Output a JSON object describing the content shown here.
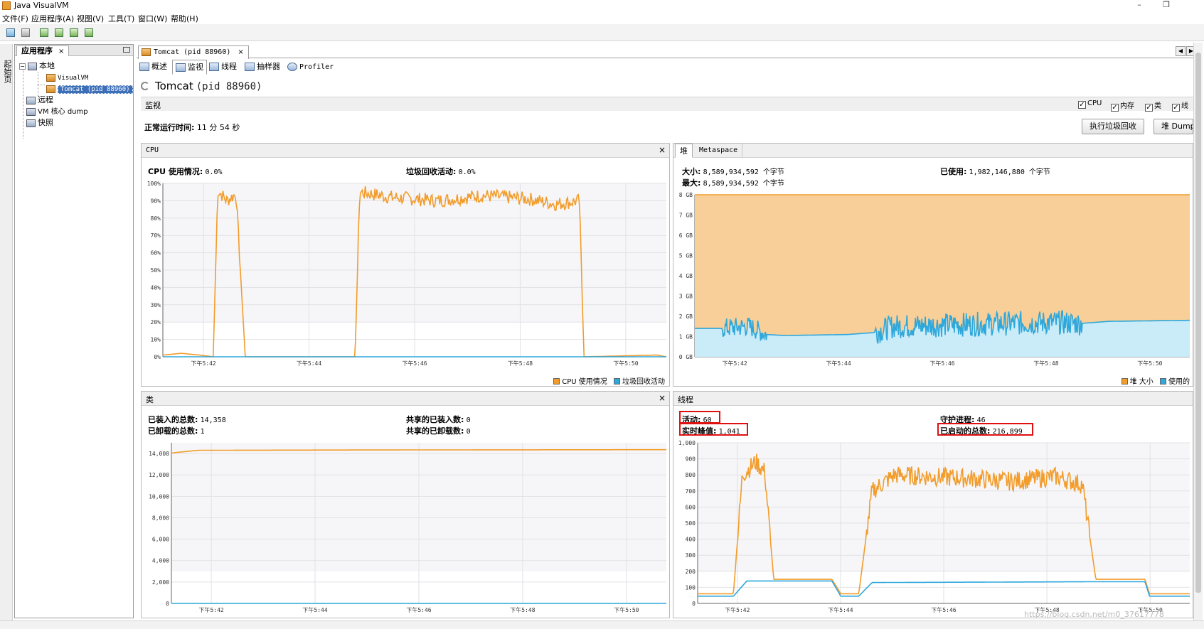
{
  "window": {
    "title": "Java VisualVM"
  },
  "menu": [
    "文件(F)",
    "应用程序(A)",
    "视图(V)",
    "工具(T)",
    "窗口(W)",
    "帮助(H)"
  ],
  "sidestrip": {
    "label": "起始页"
  },
  "left_panel": {
    "tab_label": "应用程序",
    "tree": {
      "local": "本地",
      "visualvm": "VisualVM",
      "tomcat": "Tomcat (pid 88960)",
      "remote": "远程",
      "vm_coredump": "VM 核心 dump",
      "snapshot": "快照"
    }
  },
  "doc_tab": {
    "label": "Tomcat (pid 88960)"
  },
  "sub_tabs": [
    "概述",
    "监视",
    "线程",
    "抽样器",
    "Profiler"
  ],
  "page": {
    "app_name": "Tomcat",
    "pid": "(pid 88960)"
  },
  "monitor": {
    "section_label": "监视",
    "checkboxes": [
      "CPU",
      "内存",
      "类",
      "线"
    ],
    "uptime_label": "正常运行时间:",
    "uptime_value": "11 分 54 秒",
    "gc_button": "执行垃圾回收",
    "dump_button": "堆 Dump"
  },
  "cpu_panel": {
    "title": "CPU",
    "cpu_usage_label": "CPU 使用情况:",
    "cpu_usage_value": "0.0%",
    "gc_activity_label": "垃圾回收活动:",
    "gc_activity_value": "0.0%",
    "legend": [
      "CPU 使用情况",
      "垃圾回收活动"
    ]
  },
  "heap_panel": {
    "tabs": [
      "堆",
      "Metaspace"
    ],
    "size_label": "大小:",
    "size_value": "8,589,934,592 个字节",
    "max_label": "最大:",
    "max_value": "8,589,934,592 个字节",
    "used_label": "已使用:",
    "used_value": "1,982,146,880 个字节",
    "legend": [
      "堆 大小",
      "使用的"
    ]
  },
  "classes_panel": {
    "title": "类",
    "loaded_label": "已装入的总数:",
    "loaded_value": "14,358",
    "unloaded_label": "已卸载的总数:",
    "unloaded_value": "1",
    "shared_loaded_label": "共享的已装入数:",
    "shared_loaded_value": "0",
    "shared_unloaded_label": "共享的已卸载数:",
    "shared_unloaded_value": "0"
  },
  "threads_panel": {
    "title": "线程",
    "live_label": "活动:",
    "live_value": "60",
    "peak_label": "实时峰值:",
    "peak_value": "1,041",
    "daemon_label": "守护进程:",
    "daemon_value": "46",
    "started_label": "已启动的总数:",
    "started_value": "216,899"
  },
  "time_ticks": [
    "下午5:42",
    "下午5:44",
    "下午5:46",
    "下午5:48",
    "下午5:50"
  ],
  "watermark": "https://blog.csdn.net/m0_37617778",
  "colors": {
    "orange": "#f29c2b",
    "blue": "#2ea7db",
    "heap_fill": "#f8cf98",
    "used_fill": "#c9ecf8",
    "highlight": "#e01010"
  },
  "chart_data": [
    {
      "type": "line",
      "title": "CPU",
      "x": [
        "下午5:42",
        "下午5:44",
        "下午5:46",
        "下午5:48",
        "下午5:50"
      ],
      "ylim": [
        0,
        100
      ],
      "y_ticks": [
        "0%",
        "10%",
        "20%",
        "30%",
        "40%",
        "50%",
        "60%",
        "70%",
        "80%",
        "90%",
        "100%"
      ],
      "series": [
        {
          "name": "CPU 使用情况",
          "color": "#f29c2b",
          "points": [
            [
              0,
              1
            ],
            [
              0.2,
              2
            ],
            [
              0.4,
              1
            ],
            [
              0.55,
              0
            ],
            [
              0.6,
              96
            ],
            [
              0.7,
              90
            ],
            [
              0.8,
              94
            ],
            [
              0.9,
              0
            ],
            [
              1.6,
              0
            ],
            [
              2.1,
              0
            ],
            [
              2.15,
              95
            ],
            [
              2.5,
              92
            ],
            [
              3,
              90
            ],
            [
              3.5,
              93
            ],
            [
              4,
              91
            ],
            [
              4.3,
              88
            ],
            [
              4.55,
              90
            ],
            [
              4.6,
              0
            ],
            [
              5.4,
              1
            ],
            [
              5.5,
              0
            ]
          ]
        },
        {
          "name": "垃圾回收活动",
          "color": "#2ea7db",
          "points": [
            [
              0,
              0
            ],
            [
              5.5,
              0
            ]
          ]
        }
      ]
    },
    {
      "type": "area",
      "title": "堆",
      "x": [
        "下午5:42",
        "下午5:44",
        "下午5:46",
        "下午5:48",
        "下午5:50"
      ],
      "ylim": [
        0,
        8
      ],
      "y_ticks": [
        "0 GB",
        "1 GB",
        "2 GB",
        "3 GB",
        "4 GB",
        "5 GB",
        "6 GB",
        "7 GB",
        "8 GB"
      ],
      "series": [
        {
          "name": "堆 大小",
          "color": "#f29c2b",
          "points": [
            [
              0,
              8
            ],
            [
              5.5,
              8
            ]
          ]
        },
        {
          "name": "使用的",
          "color": "#2ea7db",
          "points": [
            [
              0,
              1.4
            ],
            [
              0.3,
              1.4
            ],
            [
              0.6,
              1.5
            ],
            [
              0.8,
              1.1
            ],
            [
              1,
              1.05
            ],
            [
              1.7,
              1.1
            ],
            [
              2,
              1.2
            ],
            [
              2.2,
              1.5
            ],
            [
              3,
              1.6
            ],
            [
              4,
              1.7
            ],
            [
              4.3,
              1.65
            ],
            [
              4.6,
              1.75
            ],
            [
              5.5,
              1.8
            ]
          ]
        }
      ]
    },
    {
      "type": "line",
      "title": "类",
      "x": [
        "下午5:42",
        "下午5:44",
        "下午5:46",
        "下午5:48",
        "下午5:50"
      ],
      "ylim": [
        0,
        15000
      ],
      "y_ticks": [
        "0",
        "2,000",
        "4,000",
        "6,000",
        "8,000",
        "10,000",
        "12,000",
        "14,000"
      ],
      "series": [
        {
          "name": "已装入的总数",
          "color": "#f29c2b",
          "points": [
            [
              0,
              14050
            ],
            [
              0.3,
              14300
            ],
            [
              2.2,
              14330
            ],
            [
              5.5,
              14358
            ]
          ]
        },
        {
          "name": "共享的已装入数",
          "color": "#2ea7db",
          "points": [
            [
              0,
              0
            ],
            [
              5.5,
              0
            ]
          ]
        }
      ]
    },
    {
      "type": "line",
      "title": "线程",
      "x": [
        "下午5:42",
        "下午5:44",
        "下午5:46",
        "下午5:48",
        "下午5:50"
      ],
      "ylim": [
        0,
        1000
      ],
      "y_ticks": [
        "0",
        "100",
        "200",
        "300",
        "400",
        "500",
        "600",
        "700",
        "800",
        "900",
        "1,000"
      ],
      "series": [
        {
          "name": "活动",
          "color": "#f29c2b",
          "points": [
            [
              0,
              60
            ],
            [
              0.4,
              60
            ],
            [
              0.5,
              800
            ],
            [
              0.65,
              880
            ],
            [
              0.75,
              820
            ],
            [
              0.85,
              150
            ],
            [
              1.5,
              150
            ],
            [
              1.6,
              60
            ],
            [
              1.8,
              60
            ],
            [
              1.95,
              700
            ],
            [
              2.2,
              800
            ],
            [
              3,
              780
            ],
            [
              3.5,
              760
            ],
            [
              4,
              790
            ],
            [
              4.3,
              740
            ],
            [
              4.45,
              150
            ],
            [
              5,
              150
            ],
            [
              5.05,
              60
            ],
            [
              5.5,
              60
            ]
          ]
        },
        {
          "name": "守护进程",
          "color": "#2ea7db",
          "points": [
            [
              0,
              45
            ],
            [
              0.4,
              45
            ],
            [
              0.55,
              140
            ],
            [
              1.5,
              140
            ],
            [
              1.6,
              45
            ],
            [
              1.8,
              45
            ],
            [
              1.95,
              130
            ],
            [
              4.45,
              135
            ],
            [
              5,
              135
            ],
            [
              5.05,
              45
            ],
            [
              5.5,
              45
            ]
          ]
        }
      ]
    }
  ]
}
